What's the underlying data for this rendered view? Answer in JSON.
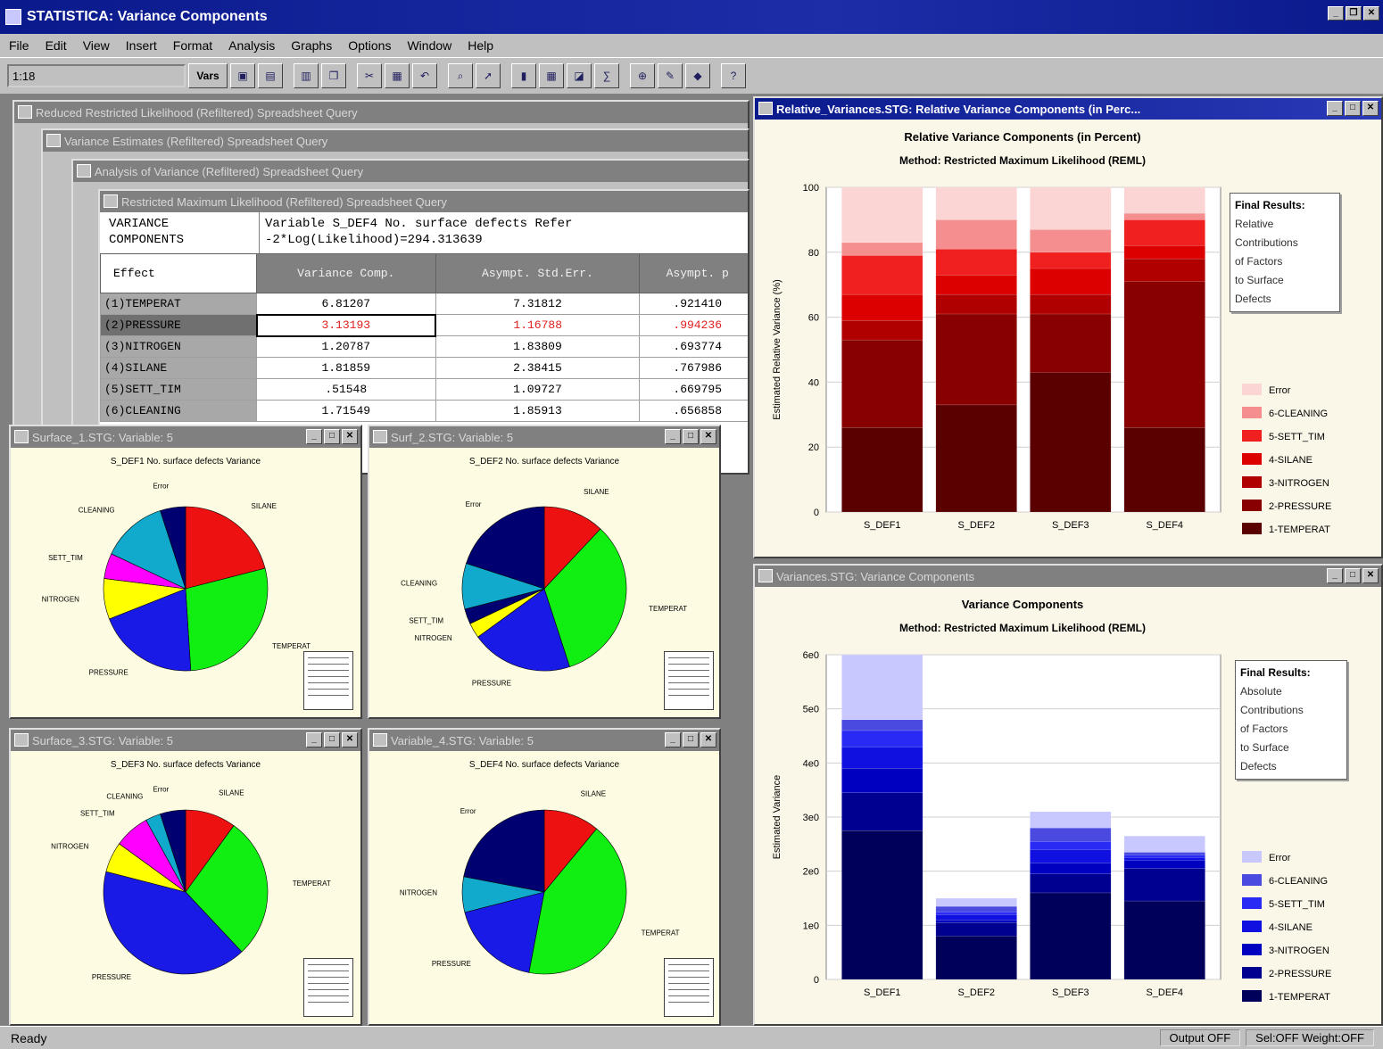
{
  "app": {
    "title": "STATISTICA: Variance Components",
    "controls": [
      "_",
      "❐",
      "✕"
    ]
  },
  "menu": [
    "File",
    "Edit",
    "View",
    "Insert",
    "Format",
    "Analysis",
    "Graphs",
    "Options",
    "Window",
    "Help"
  ],
  "toolbar": {
    "field_value": "1:18",
    "button_label": "Vars",
    "icons": [
      "open-icon",
      "save-icon",
      "print-icon",
      "copy-icon",
      "cut-icon",
      "paste-icon",
      "undo-icon",
      "find-icon",
      "pointer-icon",
      "chart-icon",
      "table-icon",
      "graph-icon",
      "stats-icon",
      "zoom-icon",
      "brush-icon",
      "label-icon",
      "help-icon"
    ]
  },
  "windows": {
    "bg1": "Reduced Restricted Likelihood (Refiltered) Spreadsheet Query",
    "bg2": "Variance Estimates (Refiltered) Spreadsheet Query",
    "bg3": "Analysis of Variance (Refiltered) Spreadsheet Query",
    "bg4": "Restricted Maximum Likelihood (Refiltered) Spreadsheet Query",
    "relative_chart": "Relative_Variances.STG: Relative Variance Components (in Perc...",
    "variance_chart": "Variances.STG: Variance Components",
    "pie1": "Surface_1.STG: Variable: 5",
    "pie2": "Surf_2.STG: Variable: 5",
    "pie3": "Surface_3.STG: Variable: 5",
    "pie4": "Variable_4.STG: Variable: 5"
  },
  "spreadsheet": {
    "corner_line1": "VARIANCE",
    "corner_line2": "COMPONENTS",
    "corner_line3": "Effect",
    "var_line1": "Variable  S_DEF4  No. surface defects  Refer",
    "var_line2": "-2*Log(Likelihood)=294.313639",
    "columns": [
      "Variance Comp.",
      "Asympt. Std.Err.",
      "Asympt. p"
    ],
    "rows": [
      {
        "num": "1",
        "effect": "(1)TEMPERAT",
        "v1": "6.81207",
        "v2": "7.31812",
        "v3": ".921410"
      },
      {
        "num": "2",
        "effect": "(2)PRESSURE",
        "v1": "3.13193",
        "v2": "1.16788",
        "v3": ".994236"
      },
      {
        "num": "3",
        "effect": "(3)NITROGEN",
        "v1": "1.20787",
        "v2": "1.83809",
        "v3": ".693774"
      },
      {
        "num": "4",
        "effect": "(4)SILANE",
        "v1": "1.81859",
        "v2": "2.38415",
        "v3": ".767986"
      },
      {
        "num": "5",
        "effect": "(5)SETT_TIM",
        "v1": ".51548",
        "v2": "1.09727",
        "v3": ".669795"
      },
      {
        "num": "6",
        "effect": "(6)CLEANING",
        "v1": "1.71549",
        "v2": "1.85913",
        "v3": ".656858"
      }
    ]
  },
  "relative": {
    "title": "Relative Variance Components (in Percent)",
    "subtitle": "Method: Restricted Maximum Likelihood (REML)",
    "ylabel": "Estimated Relative Variance (%)",
    "legend_title": "Final Results:",
    "legend_lines": [
      "Relative",
      "Contributions",
      "of Factors",
      "to Surface",
      "Defects"
    ]
  },
  "variance": {
    "title": "Variance Components",
    "subtitle": "Method: Restricted Maximum Likelihood (REML)",
    "ylabel": "Estimated Variance",
    "legend_title": "Final Results:",
    "legend_lines": [
      "Absolute",
      "Contributions",
      "of Factors",
      "to Surface",
      "Defects"
    ]
  },
  "chart_data": [
    {
      "type": "bar",
      "stacked": true,
      "title": "Relative Variance Components (in Percent)",
      "subtitle": "Method: Restricted Maximum Likelihood (REML)",
      "ylabel": "Estimated Relative Variance (%)",
      "categories": [
        "S_DEF1",
        "S_DEF2",
        "S_DEF3",
        "S_DEF4"
      ],
      "ylim": [
        0,
        100
      ],
      "yticks": [
        0,
        20,
        40,
        60,
        80,
        100
      ],
      "legend_position": "right",
      "series": [
        {
          "name": "1-TEMPERAT",
          "color": "#5a0000",
          "values": [
            26,
            33,
            43,
            26
          ]
        },
        {
          "name": "2-PRESSURE",
          "color": "#880000",
          "values": [
            27,
            28,
            18,
            45
          ]
        },
        {
          "name": "3-NITROGEN",
          "color": "#b00000",
          "values": [
            6,
            6,
            6,
            7
          ]
        },
        {
          "name": "4-SILANE",
          "color": "#dc0000",
          "values": [
            8,
            6,
            8,
            4
          ]
        },
        {
          "name": "5-SETT_TIM",
          "color": "#f02020",
          "values": [
            12,
            8,
            5,
            8
          ]
        },
        {
          "name": "6-CLEANING",
          "color": "#f58f8f",
          "values": [
            4,
            9,
            7,
            2
          ]
        },
        {
          "name": "Error",
          "color": "#fbd4d4",
          "values": [
            17,
            10,
            13,
            8
          ]
        }
      ]
    },
    {
      "type": "bar",
      "stacked": true,
      "title": "Variance Components",
      "subtitle": "Method: Restricted Maximum Likelihood (REML)",
      "ylabel": "Estimated Variance",
      "categories": [
        "S_DEF1",
        "S_DEF2",
        "S_DEF3",
        "S_DEF4"
      ],
      "ylim": [
        0,
        6
      ],
      "yticks": [
        0,
        1,
        2,
        3,
        4,
        5,
        6
      ],
      "ytick_labels": [
        "0",
        "1e0",
        "2e0",
        "3e0",
        "4e0",
        "5e0",
        "6e0"
      ],
      "legend_position": "right",
      "series": [
        {
          "name": "1-TEMPERAT",
          "color": "#00005a",
          "values": [
            2.75,
            0.8,
            1.6,
            1.45
          ]
        },
        {
          "name": "2-PRESSURE",
          "color": "#000090",
          "values": [
            0.7,
            0.25,
            0.35,
            0.6
          ]
        },
        {
          "name": "3-NITROGEN",
          "color": "#0000c0",
          "values": [
            0.45,
            0.05,
            0.2,
            0.15
          ]
        },
        {
          "name": "4-SILANE",
          "color": "#1010e0",
          "values": [
            0.4,
            0.1,
            0.25,
            0.05
          ]
        },
        {
          "name": "5-SETT_TIM",
          "color": "#2a2af5",
          "values": [
            0.3,
            0.05,
            0.15,
            0.05
          ]
        },
        {
          "name": "6-CLEANING",
          "color": "#4a4ae0",
          "values": [
            0.2,
            0.1,
            0.25,
            0.05
          ]
        },
        {
          "name": "Error",
          "color": "#c8c8ff",
          "values": [
            1.2,
            0.15,
            0.3,
            0.3
          ]
        }
      ]
    },
    {
      "type": "pie",
      "title": "S_DEF1 No. surface defects Variance",
      "slices": [
        {
          "label": "SILANE",
          "color": "#ee1111",
          "value": 21
        },
        {
          "label": "TEMPERAT",
          "color": "#11ee11",
          "value": 28
        },
        {
          "label": "PRESSURE",
          "color": "#1a1ae6",
          "value": 20
        },
        {
          "label": "NITROGEN",
          "color": "#ffff00",
          "value": 8
        },
        {
          "label": "SETT_TIM",
          "color": "#ff00ff",
          "value": 5
        },
        {
          "label": "CLEANING",
          "color": "#11aacc",
          "value": 13
        },
        {
          "label": "Error",
          "color": "#000070",
          "value": 5
        }
      ]
    },
    {
      "type": "pie",
      "title": "S_DEF2 No. surface defects Variance",
      "slices": [
        {
          "label": "SILANE",
          "color": "#ee1111",
          "value": 12
        },
        {
          "label": "TEMPERAT",
          "color": "#11ee11",
          "value": 33
        },
        {
          "label": "PRESSURE",
          "color": "#1a1ae6",
          "value": 20
        },
        {
          "label": "NITROGEN",
          "color": "#ffff00",
          "value": 3
        },
        {
          "label": "SETT_TIM",
          "color": "#000070",
          "value": 3
        },
        {
          "label": "CLEANING",
          "color": "#11aacc",
          "value": 9
        },
        {
          "label": "Error",
          "color": "#000070",
          "value": 20
        }
      ]
    },
    {
      "type": "pie",
      "title": "S_DEF3 No. surface defects Variance",
      "slices": [
        {
          "label": "SILANE",
          "color": "#ee1111",
          "value": 10
        },
        {
          "label": "TEMPERAT",
          "color": "#11ee11",
          "value": 28
        },
        {
          "label": "PRESSURE",
          "color": "#1a1ae6",
          "value": 41
        },
        {
          "label": "NITROGEN",
          "color": "#ffff00",
          "value": 6
        },
        {
          "label": "SETT_TIM",
          "color": "#ff00ff",
          "value": 7
        },
        {
          "label": "CLEANING",
          "color": "#11aacc",
          "value": 3
        },
        {
          "label": "Error",
          "color": "#000070",
          "value": 5
        }
      ]
    },
    {
      "type": "pie",
      "title": "S_DEF4 No. surface defects Variance",
      "slices": [
        {
          "label": "SILANE",
          "color": "#ee1111",
          "value": 11
        },
        {
          "label": "TEMPERAT",
          "color": "#11ee11",
          "value": 42
        },
        {
          "label": "PRESSURE",
          "color": "#1a1ae6",
          "value": 18
        },
        {
          "label": "NITROGEN",
          "color": "#11aacc",
          "value": 7
        },
        {
          "label": "Error",
          "color": "#000070",
          "value": 22
        }
      ]
    }
  ],
  "status": {
    "left": "Ready",
    "cell1": "Output OFF",
    "cell2": "Sel:OFF Weight:OFF"
  }
}
